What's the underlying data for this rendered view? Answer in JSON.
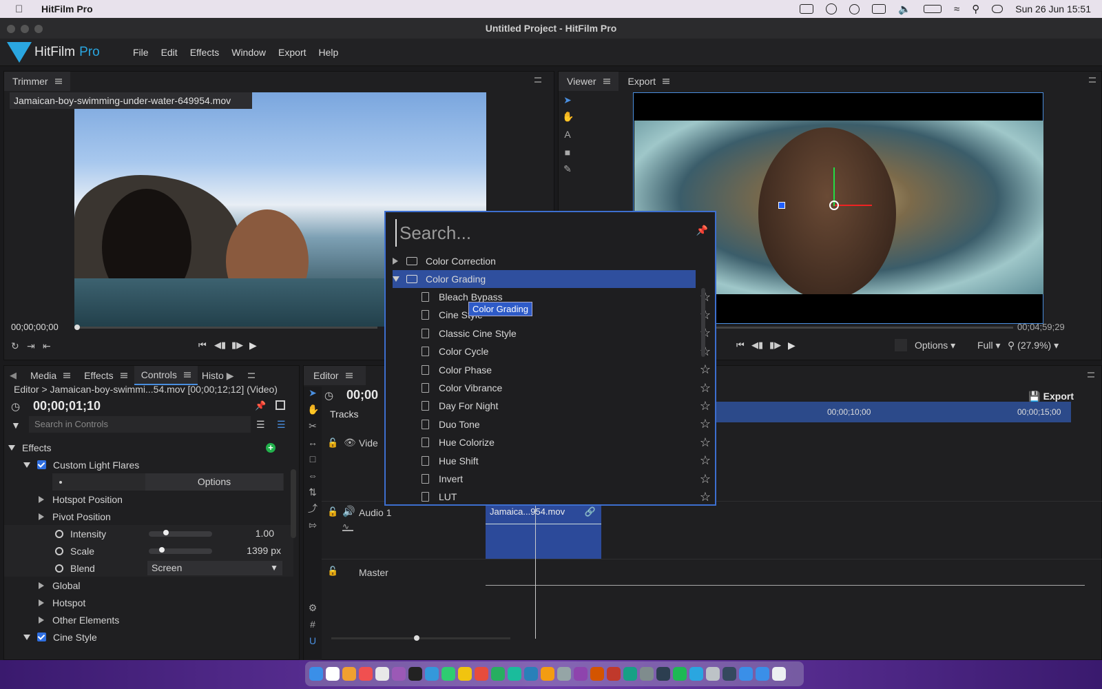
{
  "macbar": {
    "app_name": "HitFilm Pro",
    "datetime": "Sun 26 Jun  15:51"
  },
  "window": {
    "title": "Untitled Project - HitFilm Pro"
  },
  "logo": {
    "name": "HitFilm",
    "edition": "Pro"
  },
  "menu": [
    "File",
    "Edit",
    "Effects",
    "Window",
    "Export",
    "Help"
  ],
  "trimmer": {
    "tab": "Trimmer",
    "clip_name": "Jamaican-boy-swimming-under-water-649954.mov",
    "timecode": "00;00;00;00"
  },
  "viewer": {
    "tabs": [
      "Viewer",
      "Export"
    ],
    "timecode_end": "00;04;59;29",
    "options_label": "Options",
    "quality_label": "Full",
    "zoom_label": "(27.9%)"
  },
  "popup": {
    "search_placeholder": "Search...",
    "folders": [
      "Color Correction",
      "Color Grading"
    ],
    "items": [
      "Bleach Bypass",
      "Cine Style",
      "Classic Cine Style",
      "Color Cycle",
      "Color Phase",
      "Color Vibrance",
      "Day For Night",
      "Duo Tone",
      "Hue Colorize",
      "Hue Shift",
      "Invert",
      "LUT"
    ],
    "tooltip": "Color Grading"
  },
  "controls": {
    "tabs": [
      "Media",
      "Effects",
      "Controls",
      "Histo"
    ],
    "breadcrumb": "Editor > Jamaican-boy-swimmi...54.mov [00;00;12;12] (Video)",
    "timecode": "00;00;01;10",
    "search_placeholder": "Search in Controls",
    "effects_label": "Effects",
    "effect1": "Custom Light Flares",
    "options_label": "Options",
    "hotspot_position": "Hotspot Position",
    "pivot_position": "Pivot Position",
    "intensity_label": "Intensity",
    "intensity_value": "1.00",
    "intensity_level": 0.25,
    "scale_label": "Scale",
    "scale_value": "1399 px",
    "scale_level": 0.18,
    "blend_label": "Blend",
    "blend_value": "Screen",
    "global": "Global",
    "hotspot": "Hotspot",
    "other_elements": "Other Elements",
    "effect2": "Cine Style"
  },
  "editor": {
    "tab": "Editor",
    "timecode": "00;00",
    "tracks_label": "Tracks",
    "video_track": "Vide",
    "audio_track": "Audio 1",
    "master_track": "Master",
    "export_label": "Export",
    "ruler": [
      "00;00;10;00",
      "00;00;15;00"
    ],
    "audio_clip": "Jamaica...954.mov"
  },
  "colors": {
    "accent": "#4a8fe0",
    "selection": "#2f4f9e",
    "logo": "#2aa6e0"
  }
}
